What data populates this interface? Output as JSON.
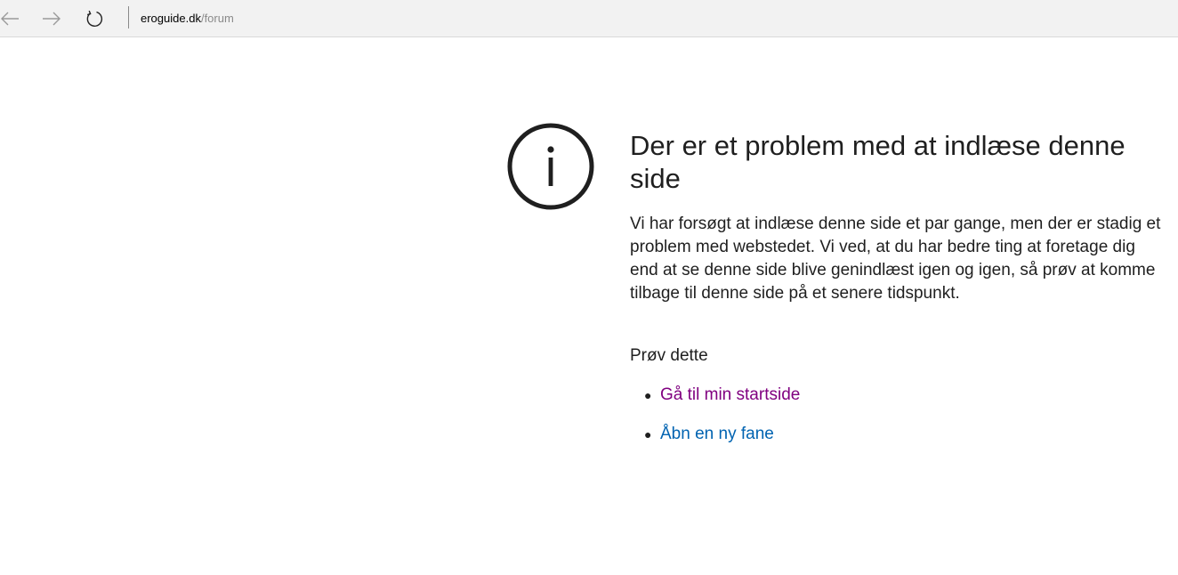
{
  "toolbar": {
    "back_icon": "back-arrow-icon",
    "forward_icon": "forward-arrow-icon",
    "refresh_icon": "refresh-icon",
    "address": {
      "domain": "eroguide.dk",
      "path": "/forum"
    }
  },
  "error": {
    "icon": "info-icon",
    "title": "Der er et problem med at indlæse denne side",
    "description": "Vi har forsøgt at indlæse denne side et par gange, men der er stadig et problem med webstedet. Vi ved, at du har bedre ting at foretage dig end at se denne side blive genindlæst igen og igen, så prøv at komme tilbage til denne side på et senere tidspunkt.",
    "try_label": "Prøv dette",
    "suggestions": [
      {
        "label": "Gå til min startside",
        "color": "#800080"
      },
      {
        "label": "Åbn en ny fane",
        "color": "#0063b1"
      }
    ]
  }
}
